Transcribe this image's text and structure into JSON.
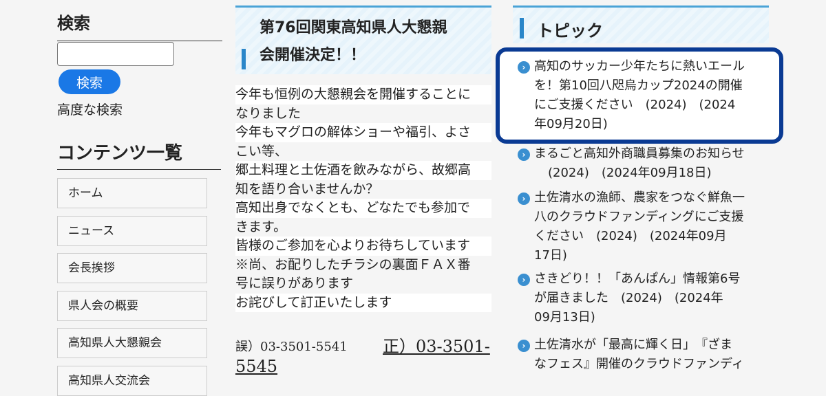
{
  "sidebar": {
    "search_heading": "検索",
    "search_placeholder": "",
    "search_button": "検索",
    "advanced_search": "高度な検索",
    "contents_heading": "コンテンツ一覧",
    "nav_items": [
      "ホーム",
      "ニュース",
      "会長挨拶",
      "県人会の概要",
      "高知県人大懇親会",
      "高知県人交流会"
    ]
  },
  "announcement": {
    "title_line1": "第76回関東高知県人大懇親",
    "title_line2": "会開催決定！！",
    "body_lines": [
      "今年も恒例の大懇親会を開催することに",
      "なりました",
      "今年もマグロの解体ショーや福引、よさ",
      "こい等、",
      "郷土料理と土佐酒を飲みながら、故郷高",
      "知を語り合いませんか？",
      "高知出身でなくとも、どなたでも参加で",
      "きます。",
      "皆様のご参加を心よりお待ちしています",
      "※尚、お配りしたチラシの裏面ＦＡＸ番",
      "号に誤りがあります",
      "お詫びして訂正いたします"
    ],
    "wrong_number": "誤）03-3501-5541",
    "right_line1": "正）03-3501-",
    "right_line2": "5545"
  },
  "topics": {
    "heading": "トピック",
    "items": [
      {
        "lines": [
          "高知のサッカー少年たちに熱いエール",
          "を！第10回八咫烏カップ2024の開催",
          "にご支援ください　(2024)　(2024",
          "年09月20日)"
        ]
      },
      {
        "lines": [
          "まるごと高知外商職員募集のお知らせ",
          "(2024)　(2024年09月18日)"
        ]
      },
      {
        "lines": [
          "土佐清水の漁師、農家をつなぐ鮮魚一",
          "八のクラウドファンディングにご支援",
          "ください　(2024)　(2024年09月",
          "17日)"
        ]
      },
      {
        "lines": [
          "さきどり！！「あんぱん」情報第6号",
          "が届きました　(2024)　(2024年",
          "09月13日)"
        ]
      },
      {
        "lines": [
          "土佐清水が「最高に輝く日」　『ざま",
          "なフェス』開催のクラウドファンディ"
        ]
      }
    ]
  },
  "icons": {
    "arrow": "chevron-right-icon"
  },
  "colors": {
    "accent": "#1a78e6",
    "highlight_border": "#0a3a93",
    "header_bar": "#2a86c9"
  }
}
